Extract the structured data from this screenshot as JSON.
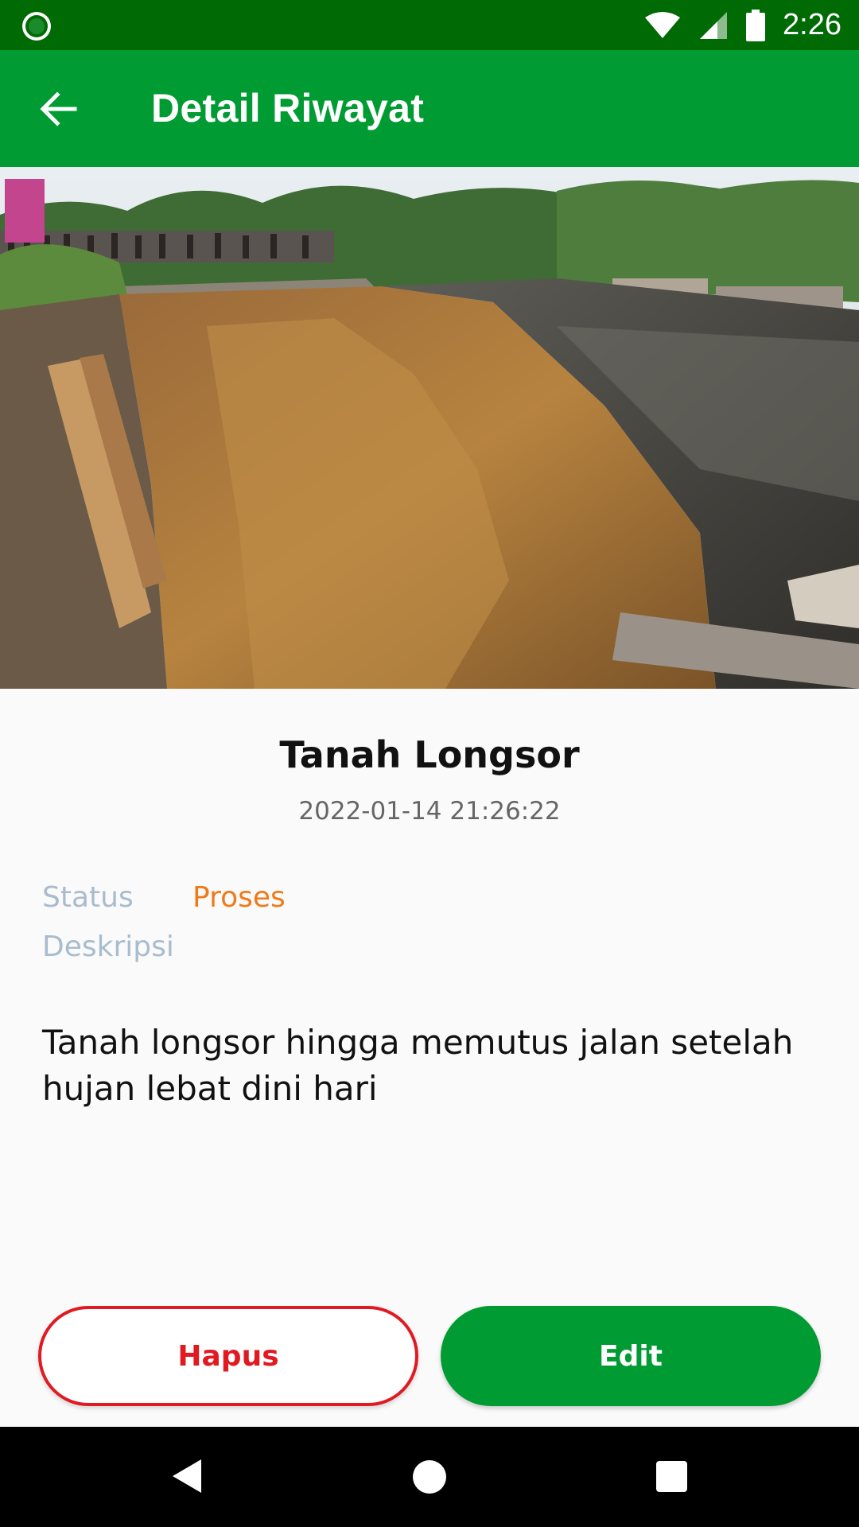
{
  "status_bar": {
    "time": "2:26"
  },
  "app_bar": {
    "title": "Detail Riwayat"
  },
  "report": {
    "title": "Tanah Longsor",
    "datetime": "2022-01-14 21:26:22",
    "status_label": "Status",
    "status_value": "Proses",
    "description_label": "Deskripsi",
    "description": "Tanah longsor hingga memutus jalan setelah hujan lebat dini hari"
  },
  "actions": {
    "delete_label": "Hapus",
    "edit_label": "Edit"
  },
  "colors": {
    "primary": "#009c33",
    "status_bar": "#006b04",
    "status_process": "#f07a1a",
    "danger": "#e11a22",
    "muted_label": "#a9bccd"
  },
  "icons": {
    "back": "arrow-left-icon",
    "wifi": "wifi-icon",
    "signal": "signal-icon",
    "battery": "battery-icon",
    "nav_back": "triangle-back-icon",
    "nav_home": "circle-home-icon",
    "nav_recent": "square-recent-icon"
  }
}
